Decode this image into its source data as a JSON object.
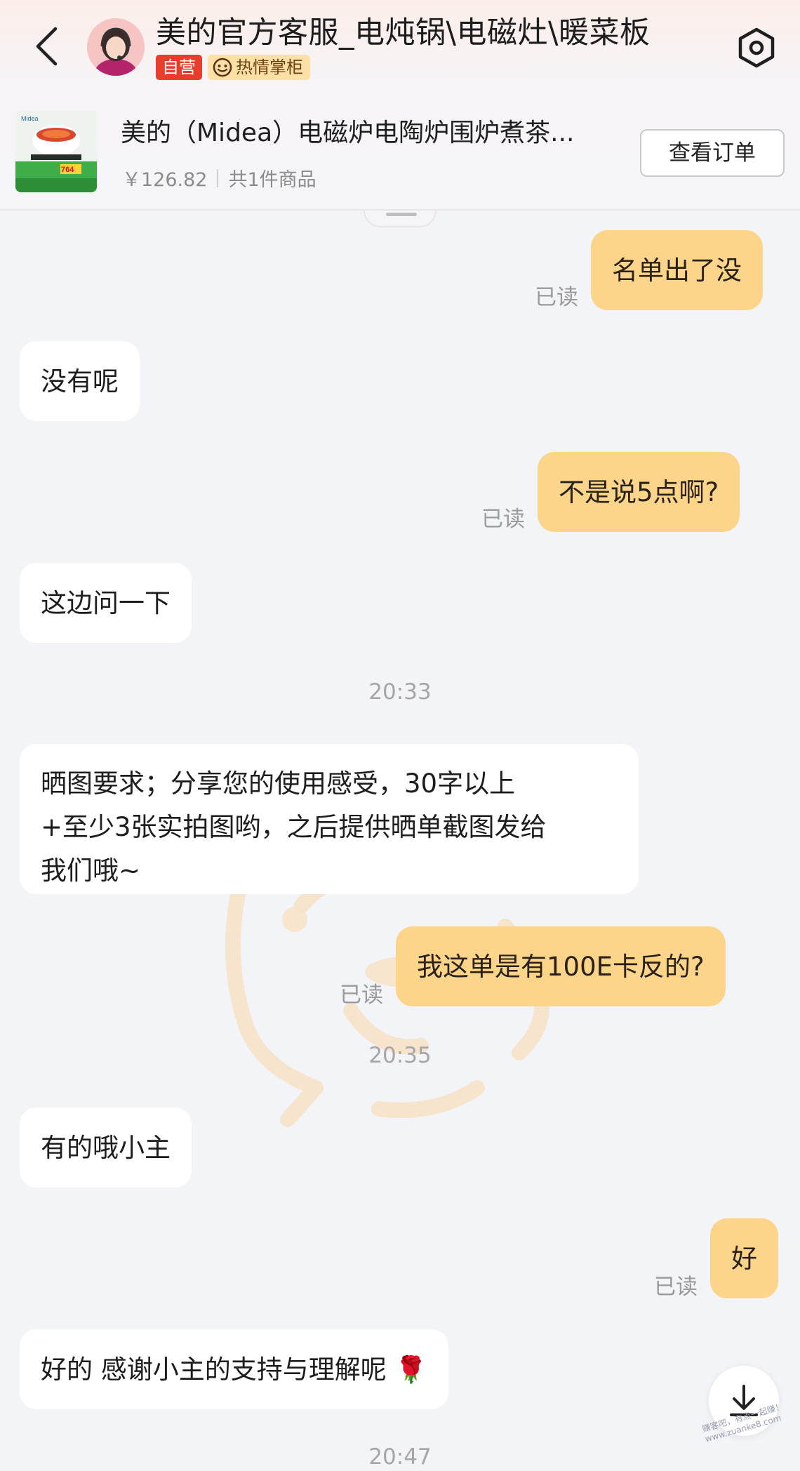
{
  "header": {
    "shop_name": "美的官方客服_电炖锅\\电磁灶\\暖菜板",
    "badge_self": "自营",
    "badge_warm": "热情掌柜",
    "back_icon": "chevron-left-icon",
    "settings_icon": "settings-hexagon-icon"
  },
  "product": {
    "thumb_brand": "Midea",
    "thumb_price": "764",
    "title": "美的（Midea）电磁炉电陶炉围炉煮茶...",
    "price": "￥126.82",
    "count": "共1件商品",
    "order_button": "查看订单"
  },
  "messages": [
    {
      "side": "out",
      "text": "名单出了没",
      "status": "已读"
    },
    {
      "side": "in",
      "text": "没有呢"
    },
    {
      "side": "out",
      "text": "不是说5点啊?",
      "status": "已读"
    },
    {
      "side": "in",
      "text": "这边问一下"
    },
    {
      "side": "time",
      "text": "20:33"
    },
    {
      "side": "in",
      "lines": [
        "晒图要求；分享您的使用感受，30字以上",
        "+至少3张实拍图哟，之后提供晒单截图发给",
        "我们哦~"
      ]
    },
    {
      "side": "out",
      "text": "我这单是有100E卡反的?",
      "status": "已读"
    },
    {
      "side": "time",
      "text": "20:35"
    },
    {
      "side": "in",
      "text": "有的哦小主"
    },
    {
      "side": "out",
      "text": "好",
      "status": "已读"
    },
    {
      "side": "in",
      "text": "好的  感谢小主的支持与理解呢 🌹"
    },
    {
      "side": "time",
      "text": "20:47"
    }
  ],
  "scroll_button_icon": "arrow-down-icon",
  "corner_watermark": "赚客吧，有点一起赚！ www.zuanke8.com",
  "colors": {
    "out_bubble": "#fcd58b",
    "in_bubble": "#ffffff",
    "background": "#f3f4f8",
    "badge_red": "#ea3c2b"
  }
}
